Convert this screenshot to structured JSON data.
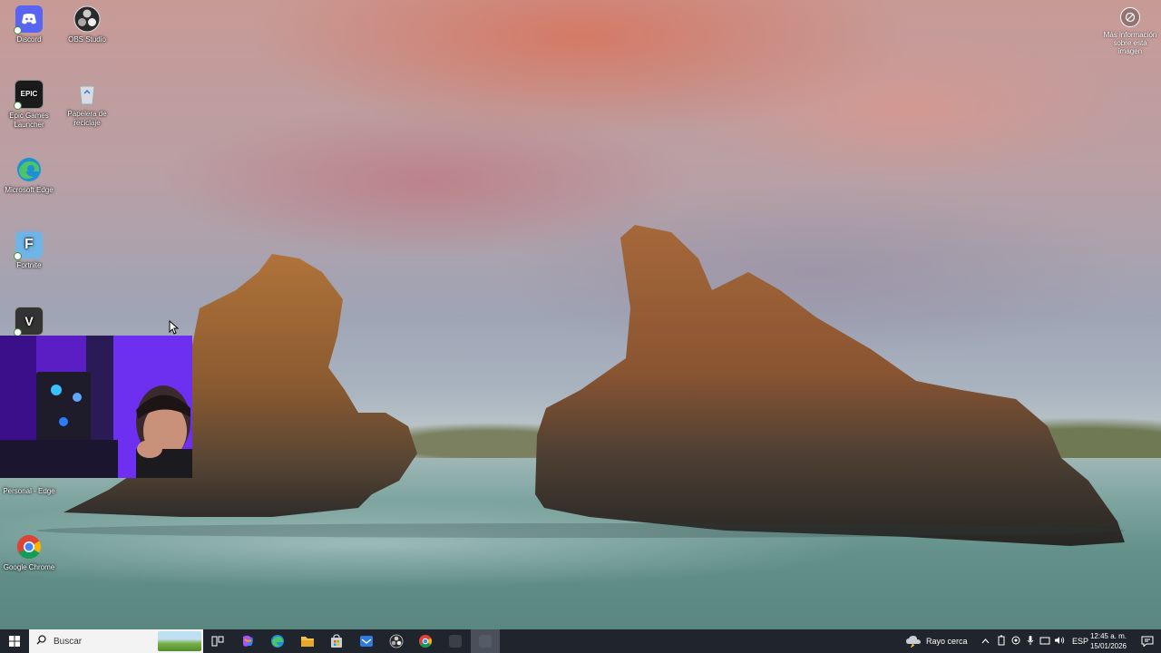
{
  "desktop": {
    "icons": [
      {
        "label": "Discord",
        "icon": "discord-icon",
        "color": "#5865f2"
      },
      {
        "label": "OBS Studio",
        "icon": "obs-icon",
        "color": "#2a2a2a"
      },
      {
        "label": "Epic Games Launcher",
        "icon": "epic-games-icon",
        "color": "#1b1b1b",
        "glyph": "EPIC"
      },
      {
        "label": "Papelera de reciclaje",
        "icon": "recycle-bin-icon",
        "color": "#cfd8df"
      },
      {
        "label": "Microsoft Edge",
        "icon": "edge-icon",
        "color": "#1f8fd6"
      },
      {
        "label": "Fortnite",
        "icon": "fortnite-icon",
        "color": "#6fb4e6",
        "glyph": "F"
      },
      {
        "label": "",
        "icon": "gta-v-icon",
        "color": "#333333",
        "glyph": "V"
      },
      {
        "label": "Personal - Edge",
        "icon": "edge-profile-icon",
        "color": "#1f8fd6"
      },
      {
        "label": "Google Chrome",
        "icon": "chrome-icon",
        "color": "#db4437"
      }
    ],
    "wallpaper_info": {
      "label": "Más información sobre esta imagen",
      "icon": "camera-info-icon"
    }
  },
  "webcam": {
    "description": "streamer webcam overlay"
  },
  "taskbar": {
    "start_icon": "windows-start-icon",
    "search_placeholder": "Buscar",
    "apps": [
      {
        "name": "task-view",
        "icon": "task-view-icon",
        "color": "#ffffff"
      },
      {
        "name": "copilot",
        "icon": "copilot-icon",
        "color": "#a855f7"
      },
      {
        "name": "edge",
        "icon": "edge-icon",
        "color": "#1f8fd6"
      },
      {
        "name": "file-explorer",
        "icon": "folder-icon",
        "color": "#f2c14e"
      },
      {
        "name": "store",
        "icon": "store-icon",
        "color": "#cfcfcf"
      },
      {
        "name": "mail",
        "icon": "mail-icon",
        "color": "#2f7be0"
      },
      {
        "name": "obs",
        "icon": "obs-icon",
        "color": "#2a2a2a"
      },
      {
        "name": "chrome",
        "icon": "chrome-icon",
        "color": "#db4437"
      },
      {
        "name": "active-app",
        "icon": "app-icon",
        "color": "#555b66"
      }
    ],
    "weather": {
      "text": "Rayo cerca",
      "icon": "storm-cloud-icon"
    },
    "tray_icons": [
      "chevron-up-icon",
      "battery-icon",
      "network-icon",
      "microphone-icon",
      "wifi-icon",
      "volume-icon"
    ],
    "language": "ESP",
    "time": "12:45 a. m.",
    "date": "15/01/2026",
    "notification_icon": "notification-icon"
  }
}
